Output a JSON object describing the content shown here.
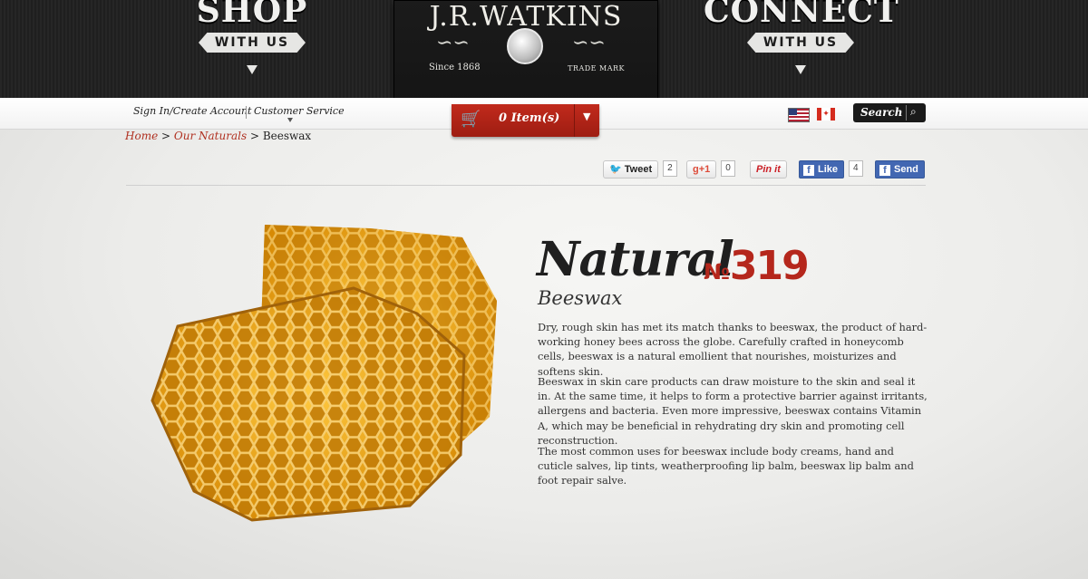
{
  "header": {
    "shop": {
      "title": "SHOP",
      "ribbon": "WITH US"
    },
    "connect": {
      "title": "CONNECT",
      "ribbon": "WITH US"
    },
    "logo": {
      "name": "J.R.WATKINS",
      "since": "Since 1868",
      "trademark": "TRADE MARK"
    }
  },
  "account_bar": {
    "sign_in": "Sign In/Create Account",
    "customer_service": "Customer Service",
    "cart_label": "0 Item(s)",
    "search_label": "Search"
  },
  "breadcrumb": {
    "home": "Home",
    "section": "Our Naturals",
    "current": "Beeswax",
    "separator": ">"
  },
  "social": {
    "tweet": {
      "label": "Tweet",
      "count": "2"
    },
    "gplus": {
      "label": "+1",
      "count": "0"
    },
    "pinterest": {
      "label": "Pin it"
    },
    "facebook_like": {
      "label": "Like",
      "count": "4"
    },
    "facebook_send": {
      "label": "Send"
    }
  },
  "product": {
    "script_title": "Natural",
    "number_prefix": "№",
    "number": "319",
    "name": "Beeswax",
    "paragraphs": [
      "Dry, rough skin has met its match thanks to beeswax, the product of hard-working honey bees across the globe. Carefully crafted in honeycomb cells, beeswax is a natural emollient that nourishes, moisturizes and softens skin.",
      "Beeswax in skin care products can draw moisture to the skin and seal it in. At the same time, it helps to form a protective barrier against irritants, allergens and bacteria. Even more impressive, beeswax contains Vitamin A, which may be beneficial in rehydrating dry skin and promoting cell reconstruction.",
      "The most common uses for beeswax include body creams, hand and cuticle salves, lip tints, weatherproofing lip balm, beeswax lip balm and foot repair salve."
    ]
  },
  "colors": {
    "accent_red": "#b5271c",
    "header_dark": "#222222",
    "cart_red": "#b22417",
    "link_red": "#b03020"
  },
  "icons": [
    "cart-icon",
    "search-icon",
    "twitter-icon",
    "facebook-icon",
    "us-flag-icon",
    "canada-flag-icon",
    "honeycomb-image"
  ]
}
